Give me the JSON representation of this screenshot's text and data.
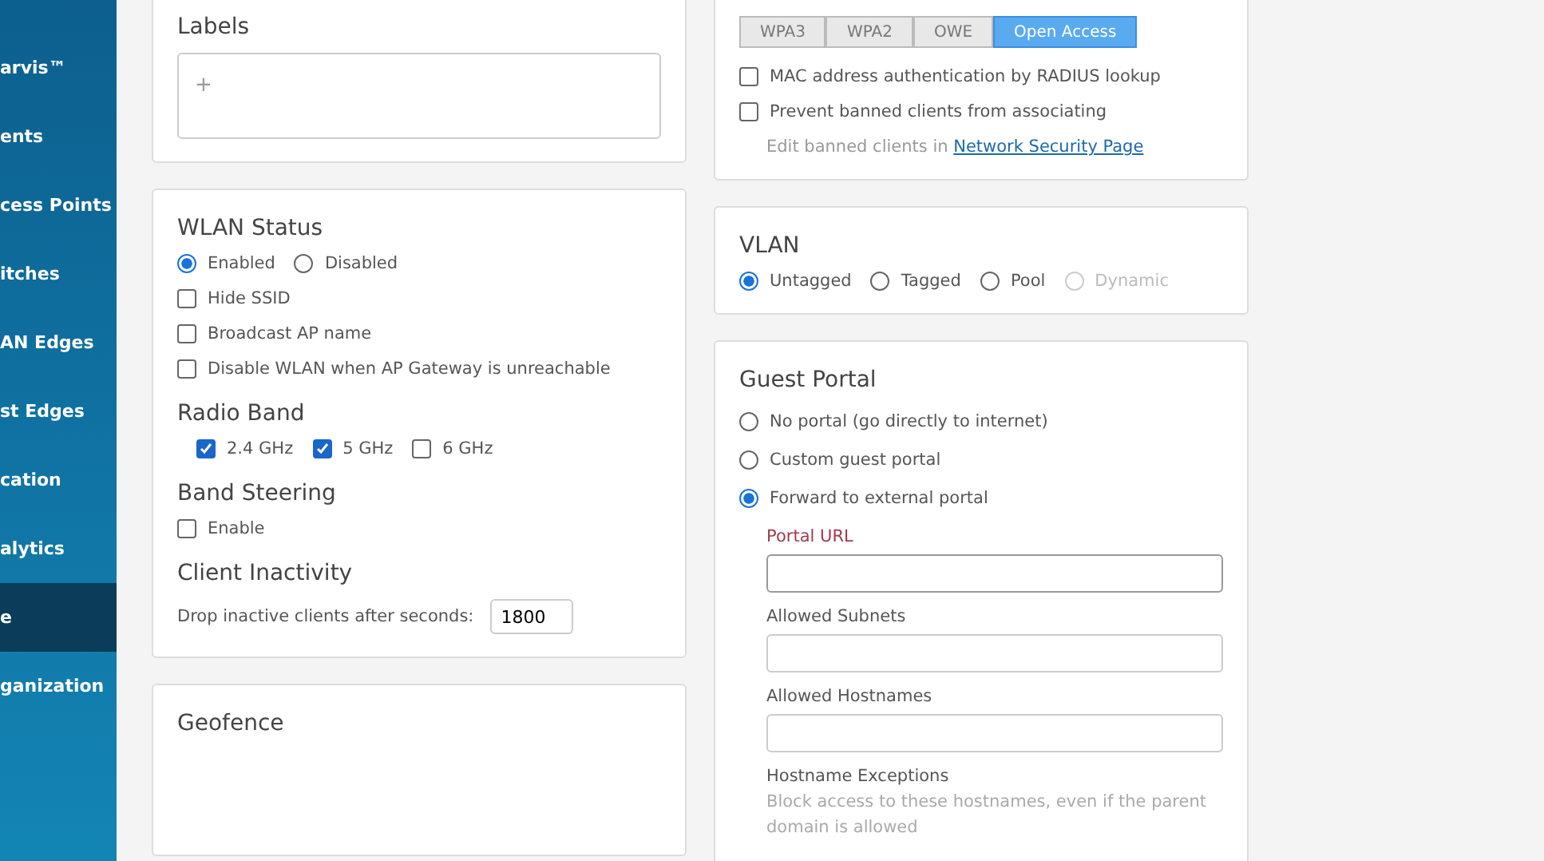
{
  "sidebar": {
    "items": [
      {
        "label": "arvis™",
        "selected": false
      },
      {
        "label": "ents",
        "selected": false
      },
      {
        "label": "cess Points",
        "selected": false
      },
      {
        "label": "itches",
        "selected": false
      },
      {
        "label": "AN Edges",
        "selected": false
      },
      {
        "label": "st Edges",
        "selected": false
      },
      {
        "label": "cation",
        "selected": false
      },
      {
        "label": "alytics",
        "selected": false
      },
      {
        "label": "e",
        "selected": true
      },
      {
        "label": "ganization",
        "selected": false
      }
    ]
  },
  "labels": {
    "title": "Labels",
    "add": "+"
  },
  "wlan_status": {
    "title": "WLAN Status",
    "options": [
      {
        "label": "Enabled",
        "selected": true
      },
      {
        "label": "Disabled",
        "selected": false
      }
    ],
    "checks": [
      {
        "label": "Hide SSID",
        "checked": false
      },
      {
        "label": "Broadcast AP name",
        "checked": false
      },
      {
        "label": "Disable WLAN when AP Gateway is unreachable",
        "checked": false
      }
    ]
  },
  "radio_band": {
    "title": "Radio Band",
    "bands": [
      {
        "label": "2.4 GHz",
        "checked": true
      },
      {
        "label": "5 GHz",
        "checked": true
      },
      {
        "label": "6 GHz",
        "checked": false
      }
    ]
  },
  "band_steering": {
    "title": "Band Steering",
    "enable": {
      "label": "Enable",
      "checked": false
    }
  },
  "client_inactivity": {
    "title": "Client Inactivity",
    "label": "Drop inactive clients after seconds:",
    "value": "1800"
  },
  "geofence": {
    "title": "Geofence"
  },
  "security": {
    "tabs": [
      {
        "label": "WPA3",
        "selected": false
      },
      {
        "label": "WPA2",
        "selected": false
      },
      {
        "label": "OWE",
        "selected": false
      },
      {
        "label": "Open Access",
        "selected": true
      }
    ],
    "checks": [
      {
        "label": "MAC address authentication by RADIUS lookup",
        "checked": false
      },
      {
        "label": "Prevent banned clients from associating",
        "checked": false
      }
    ],
    "note": "Edit banned clients in",
    "link": "Network Security Page"
  },
  "vlan": {
    "title": "VLAN",
    "options": [
      {
        "label": "Untagged",
        "selected": true,
        "disabled": false
      },
      {
        "label": "Tagged",
        "selected": false,
        "disabled": false
      },
      {
        "label": "Pool",
        "selected": false,
        "disabled": false
      },
      {
        "label": "Dynamic",
        "selected": false,
        "disabled": true
      }
    ]
  },
  "guest_portal": {
    "title": "Guest Portal",
    "options": [
      {
        "label": "No portal (go directly to internet)",
        "selected": false
      },
      {
        "label": "Custom guest portal",
        "selected": false
      },
      {
        "label": "Forward to external portal",
        "selected": true
      }
    ],
    "fields": [
      {
        "label": "Portal URL",
        "required": true,
        "focused": true
      },
      {
        "label": "Allowed Subnets",
        "required": false,
        "focused": false
      },
      {
        "label": "Allowed Hostnames",
        "required": false,
        "focused": false
      }
    ],
    "exceptions": {
      "label": "Hostname Exceptions",
      "hint": "Block access to these hostnames, even if the parent domain is allowed"
    }
  }
}
